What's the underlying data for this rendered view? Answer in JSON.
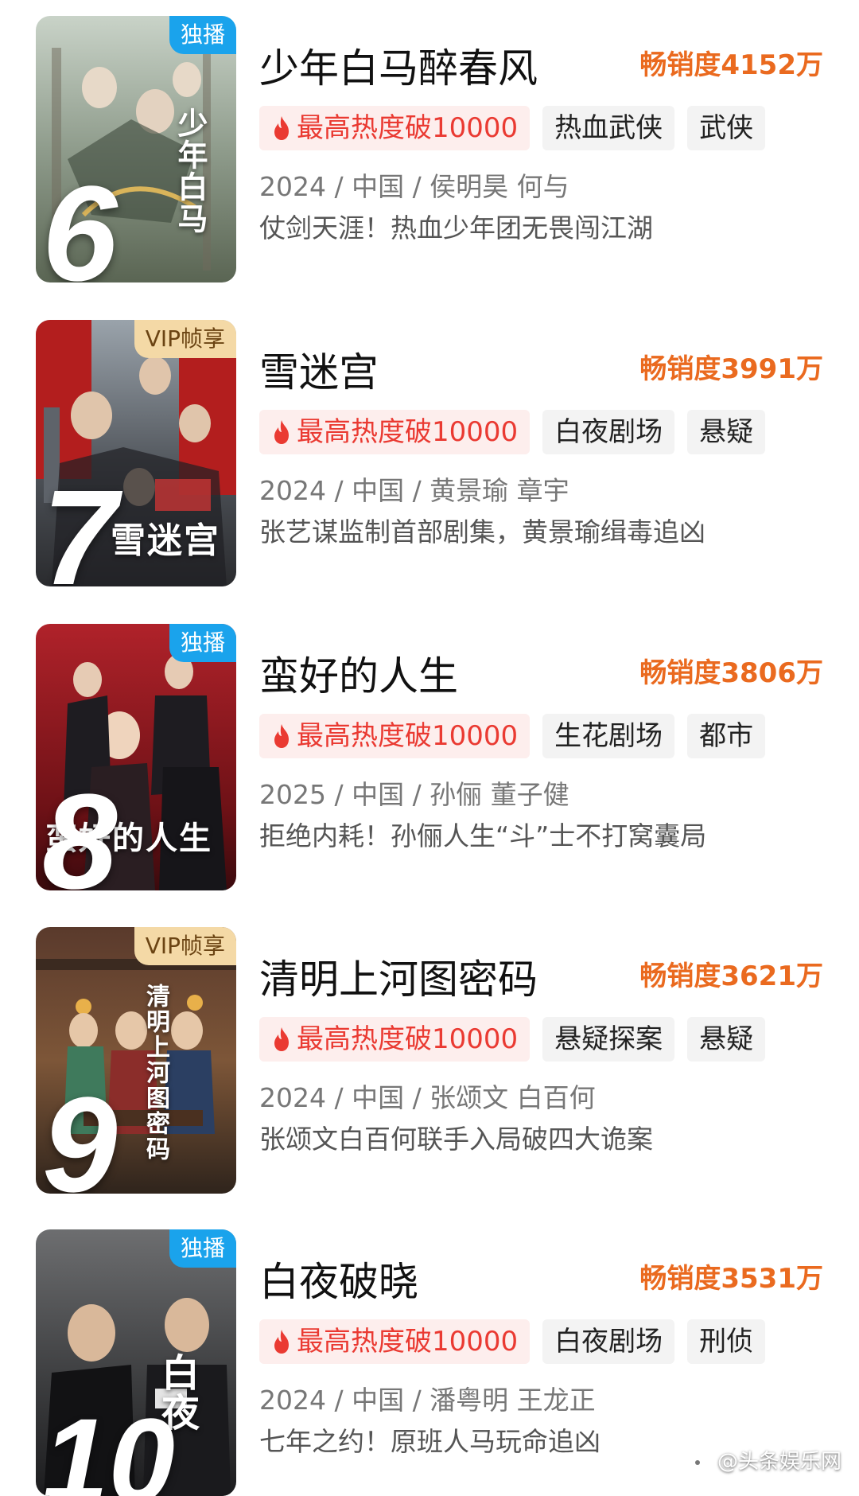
{
  "items": [
    {
      "rank": "6",
      "badge": "独播",
      "poster_title": "少年白马",
      "title": "少年白马醉春风",
      "sales": "畅销度4152万",
      "hot": "最高热度破10000",
      "tags": [
        "热血武侠",
        "武侠"
      ],
      "meta": "2024 / 中国 / 侯明昊 何与",
      "desc": "仗剑天涯！热血少年团无畏闯江湖"
    },
    {
      "rank": "7",
      "badge": "VIP帧享",
      "poster_title": "雪迷宫",
      "title": "雪迷宫",
      "sales": "畅销度3991万",
      "hot": "最高热度破10000",
      "tags": [
        "白夜剧场",
        "悬疑"
      ],
      "meta": "2024 / 中国 / 黄景瑜 章宇",
      "desc": "张艺谋监制首部剧集，黄景瑜缉毒追凶"
    },
    {
      "rank": "8",
      "badge": "独播",
      "poster_title": "蛮好的人生",
      "title": "蛮好的人生",
      "sales": "畅销度3806万",
      "hot": "最高热度破10000",
      "tags": [
        "生花剧场",
        "都市"
      ],
      "meta": "2025 / 中国 / 孙俪 董子健",
      "desc": "拒绝内耗！孙俪人生“斗”士不打窝囊局"
    },
    {
      "rank": "9",
      "badge": "VIP帧享",
      "poster_title": "清明上河图密码",
      "title": "清明上河图密码",
      "sales": "畅销度3621万",
      "hot": "最高热度破10000",
      "tags": [
        "悬疑探案",
        "悬疑"
      ],
      "meta": "2024 / 中国 / 张颂文 白百何",
      "desc": "张颂文白百何联手入局破四大诡案"
    },
    {
      "rank": "10",
      "badge": "独播",
      "poster_title": "白夜",
      "title": "白夜破晓",
      "sales": "畅销度3531万",
      "hot": "最高热度破10000",
      "tags": [
        "白夜剧场",
        "刑侦"
      ],
      "meta": "2024 / 中国 / 潘粤明 王龙正",
      "desc": "七年之约！原班人马玩命追凶"
    }
  ],
  "watermark": "@头条娱乐网",
  "colors": {
    "accent_orange": "#ea6a1f",
    "hot_red": "#ea3a32",
    "badge_blue": "#1aa3ec",
    "badge_vip": "#f4d9a6"
  }
}
